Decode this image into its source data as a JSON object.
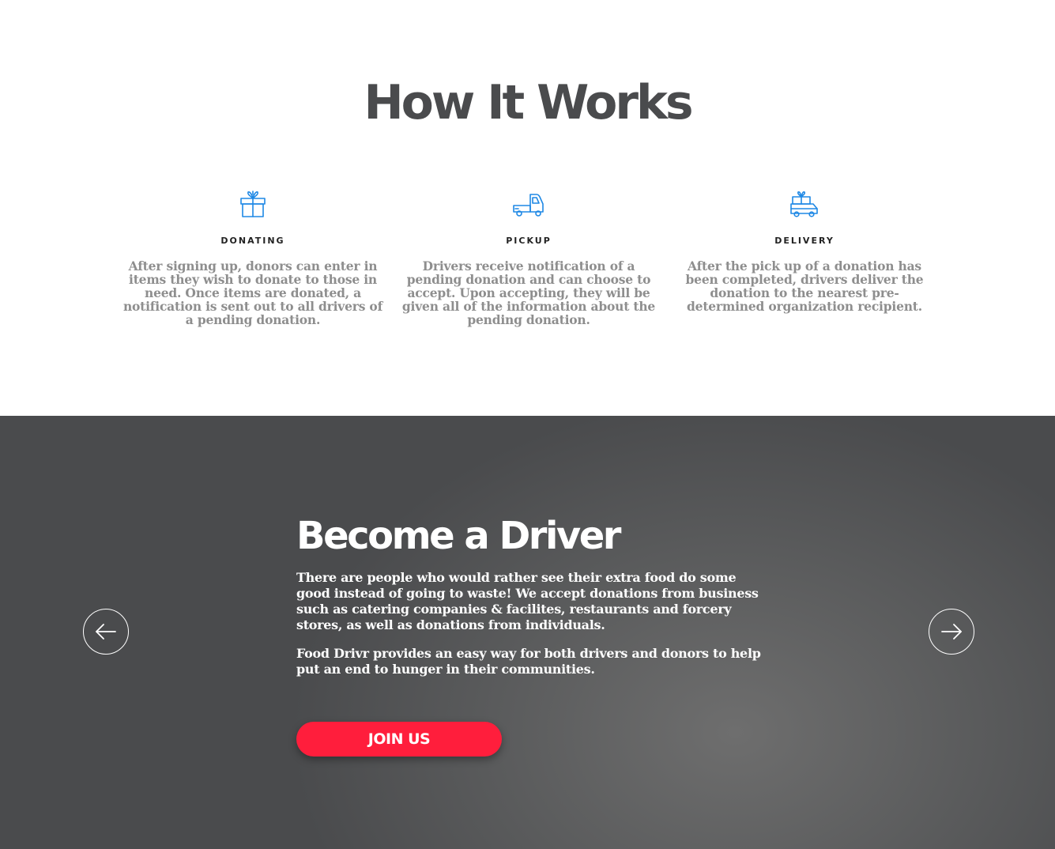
{
  "how_it_works": {
    "title": "How It Works",
    "steps": [
      {
        "icon": "gift-icon",
        "label": "DONATING",
        "text": "After signing up, donors can enter in items they wish to donate to those in need. Once items are donated, a notification is sent out to all drivers of a pending donation."
      },
      {
        "icon": "pickup-truck-icon",
        "label": "PICKUP",
        "text": "Drivers receive notification of a pending donation and can choose to accept. Upon accepting, they will be given all of the information about the pending donation."
      },
      {
        "icon": "delivery-van-icon",
        "label": "DELIVERY",
        "text": "After the pick up of a donation has been completed, drivers deliver the donation to the nearest pre-determined organization recipient."
      }
    ]
  },
  "driver": {
    "title": "Become a Driver",
    "paragraph1": "There are people who would rather see their extra food do some good instead of going to waste! We accept donations from business such as catering companies & facilites, restaurants and forcery stores, as well as donations from individuals.",
    "paragraph2": "Food Drivr provides an easy way for both drivers and donors to help put an end to hunger in their communities.",
    "button_label": "JOIN US",
    "prev_icon": "arrow-left-icon",
    "next_icon": "arrow-right-icon"
  },
  "colors": {
    "icon_blue": "#1e88e5",
    "button_red": "#ff1e3c",
    "title_gray": "#4a4b4d",
    "body_gray": "#8e8e8e"
  }
}
